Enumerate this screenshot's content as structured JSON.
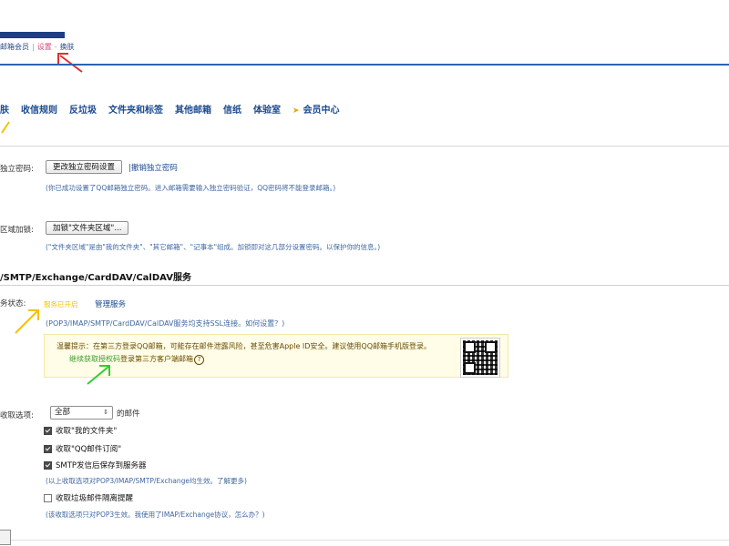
{
  "account_bar": {
    "member_label": "邮箱会员",
    "settings_label": "设置",
    "dash": "-",
    "skin_label": "换肤",
    "separator": "|"
  },
  "nav": {
    "items": [
      "肤",
      "收信规则",
      "反垃圾",
      "文件夹和标签",
      "其他邮箱",
      "信纸",
      "体验室",
      "会员中心"
    ]
  },
  "independent_password": {
    "label": "独立密码:",
    "change_button": "更改独立密码设置",
    "revoke_link": "|撤销独立密码",
    "hint": "(你已成功设置了QQ邮箱独立密码。进入邮箱需要输入独立密码验证，QQ密码将不能登录邮箱。)"
  },
  "folder_lock": {
    "label": "区域加锁:",
    "button": "加锁\"文件夹区域\"...",
    "hint": "(\"文件夹区域\"是由\"我的文件夹\"、\"其它邮箱\"、\"记事本\"组成。加锁即对这几部分设置密码。以保护你的信息。)"
  },
  "protocol_section": {
    "title": "/SMTP/Exchange/CardDAV/CalDAV服务",
    "status_label": "务状态:",
    "enabled_text": "服务已开启",
    "manage_link": "管理服务",
    "ssl_hint": "(POP3/IMAP/SMTP/CardDAV/CalDAV服务均支持SSL连接。如何设置？)",
    "notice_line1": "温馨提示：在第三方登录QQ邮箱，可能存在邮件泄露风险，甚至危害Apple ID安全。建议使用QQ邮箱手机版登录。",
    "notice_link": "继续获取授权码",
    "notice_line2": "登录第三方客户端邮箱",
    "notice_help_icon": "?"
  },
  "receive_options": {
    "label": "收取选项:",
    "select_value": "全部",
    "select_suffix": "的邮件",
    "checkboxes": [
      {
        "label": "收取\"我的文件夹\"",
        "checked": true
      },
      {
        "label": "收取\"QQ邮件订阅\"",
        "checked": true
      },
      {
        "label": "SMTP发信后保存到服务器",
        "checked": true
      }
    ],
    "hint1": "(以上收取选项对POP3/IMAP/SMTP/Exchange均生效。了解更多)",
    "spam_checkbox": {
      "label": "收取垃圾邮件隔离提醒",
      "checked": false
    },
    "hint2": "(该收取选项只对POP3生效。我使用了IMAP/Exchange协议，怎么办？)"
  },
  "colors": {
    "brand_blue": "#1b4a8f",
    "accent_pink": "#e0457a",
    "arrow_red": "#e03030",
    "arrow_yellow": "#f2c200",
    "arrow_green": "#33cc33"
  }
}
